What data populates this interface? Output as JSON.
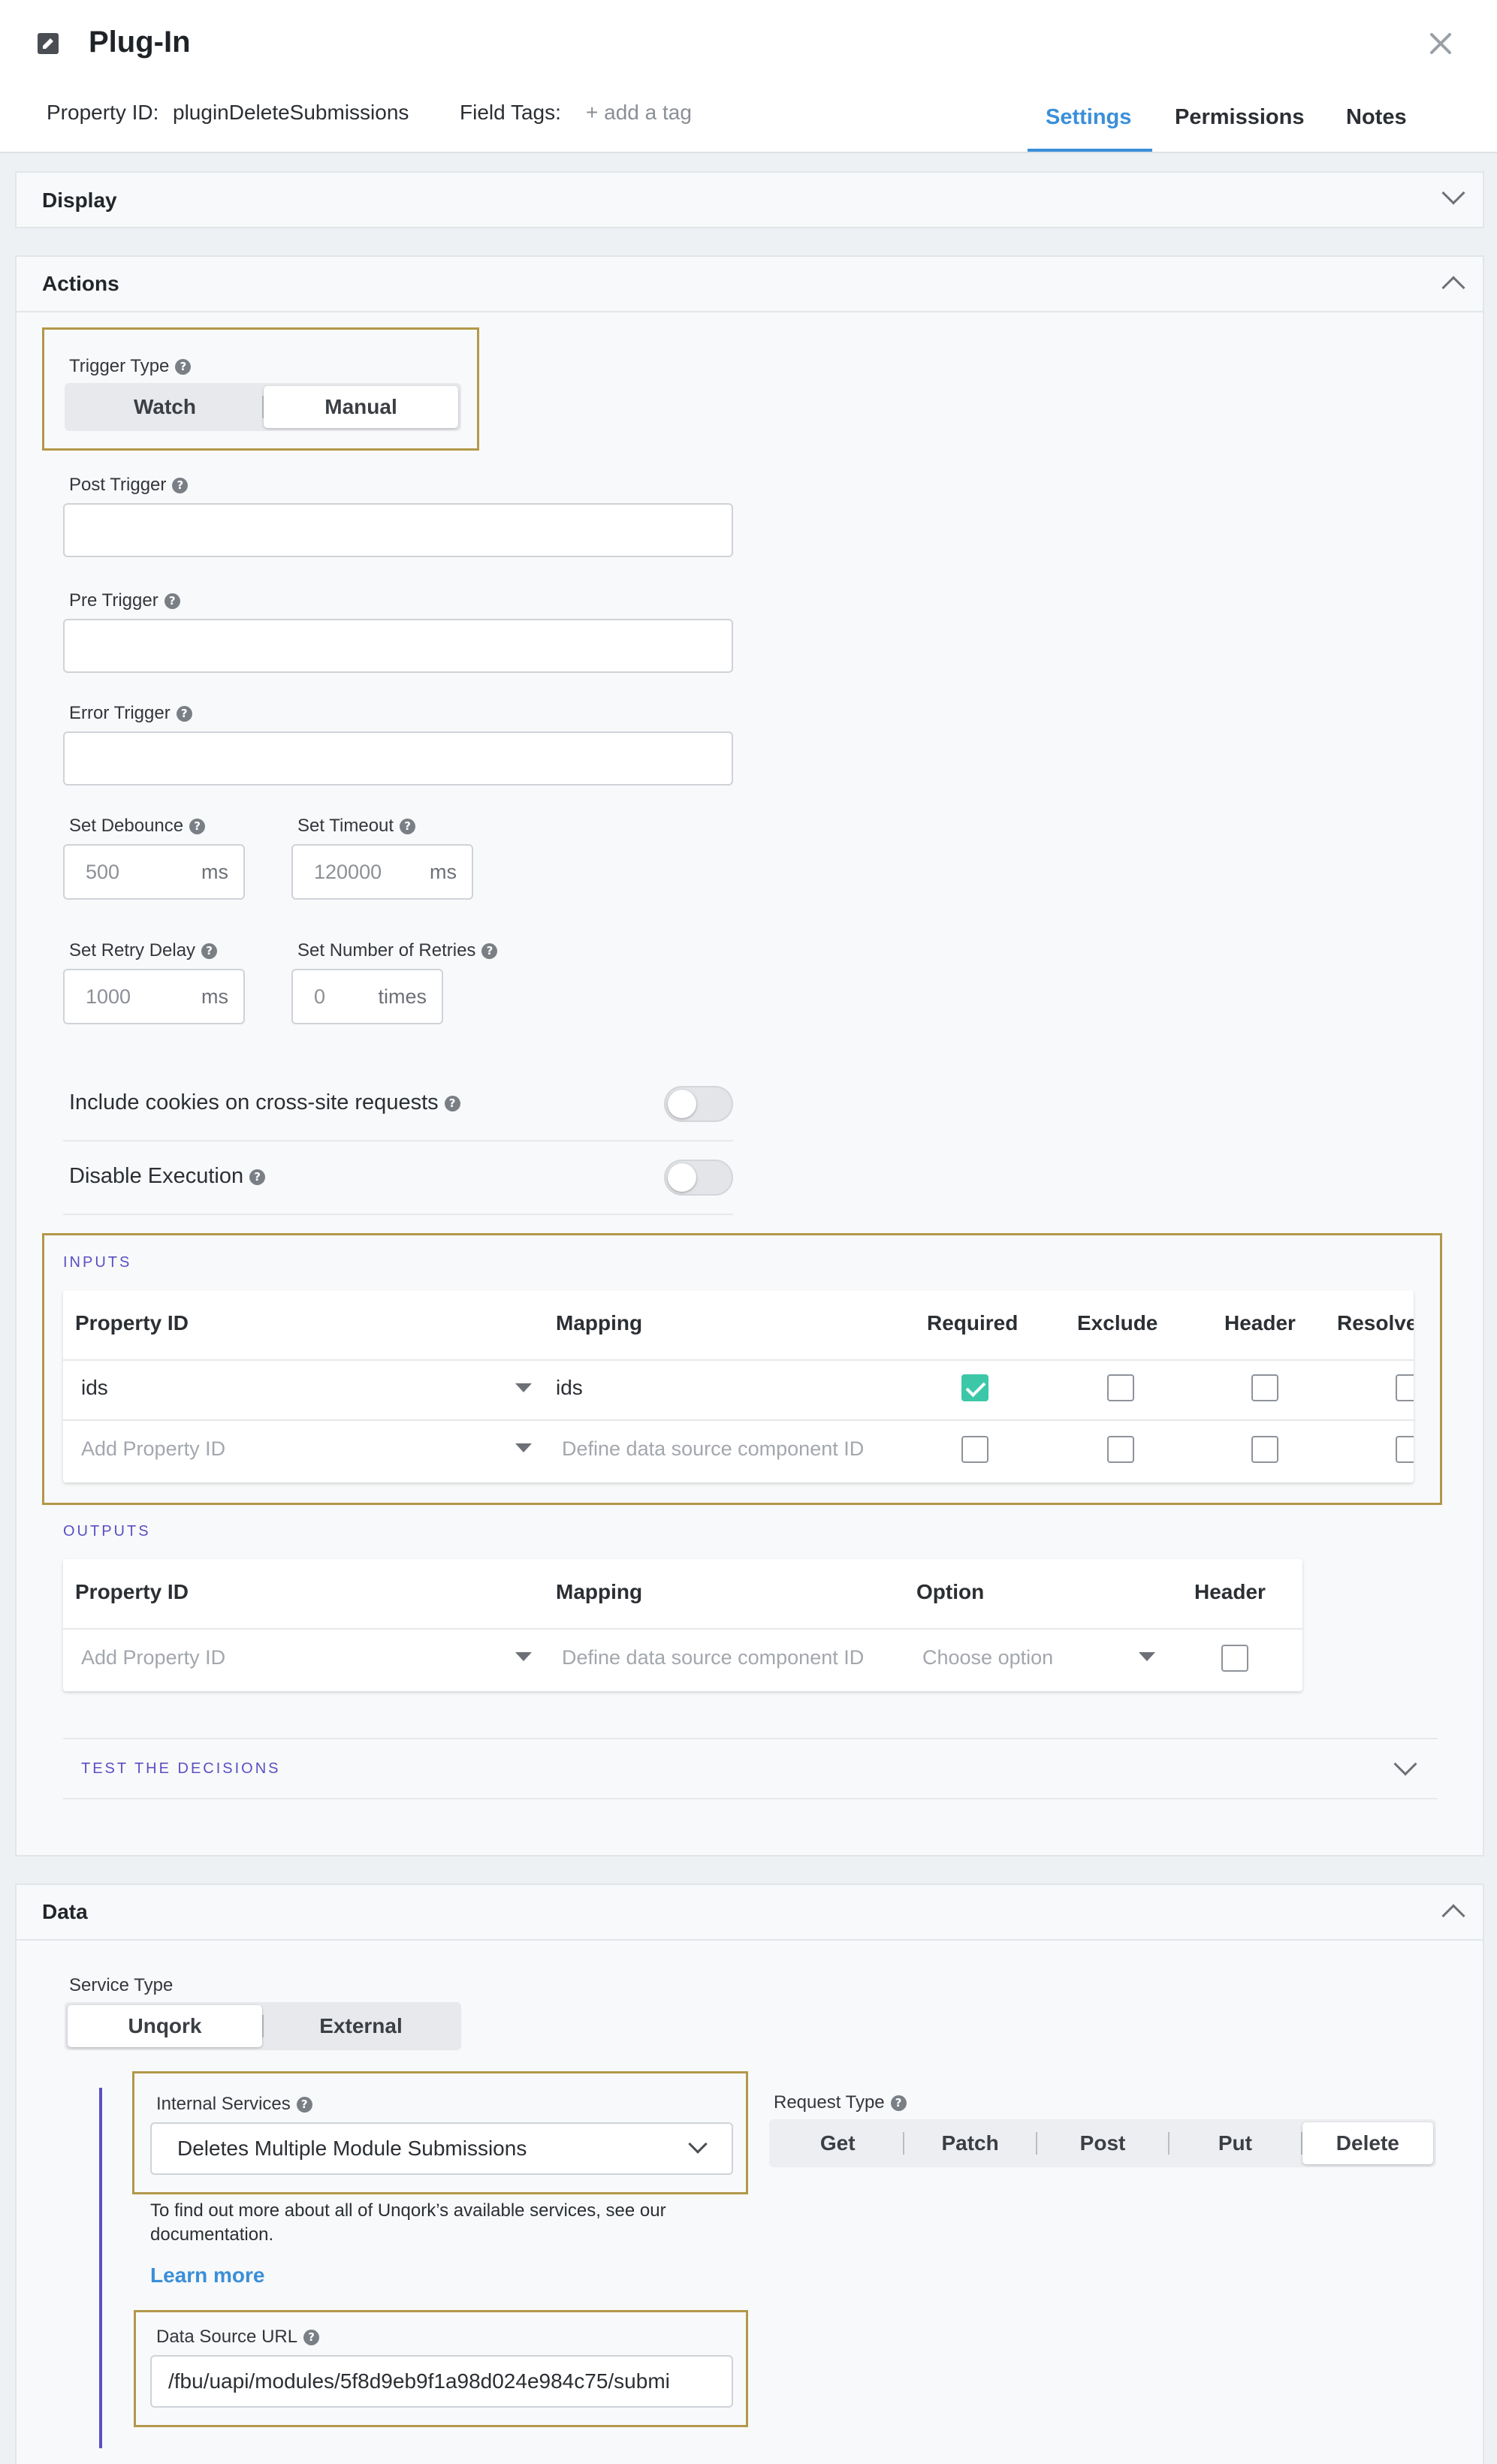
{
  "header": {
    "title": "Plug-In",
    "property_id_label": "Property ID:",
    "property_id_value": "pluginDeleteSubmissions",
    "field_tags_label": "Field Tags:",
    "add_tag": "+ add a tag",
    "tabs": [
      {
        "label": "Settings",
        "active": true
      },
      {
        "label": "Permissions",
        "active": false
      },
      {
        "label": "Notes",
        "active": false
      }
    ],
    "accent_color": "#3a8fd9"
  },
  "display_panel": {
    "title": "Display"
  },
  "actions_panel": {
    "title": "Actions",
    "trigger_type": {
      "label": "Trigger Type",
      "options": [
        "Watch",
        "Manual"
      ],
      "selected": "Manual"
    },
    "post_trigger": {
      "label": "Post Trigger",
      "value": ""
    },
    "pre_trigger": {
      "label": "Pre Trigger",
      "value": ""
    },
    "error_trigger": {
      "label": "Error Trigger",
      "value": ""
    },
    "debounce": {
      "label": "Set Debounce",
      "placeholder": "500",
      "unit": "ms"
    },
    "timeout": {
      "label": "Set Timeout",
      "placeholder": "120000",
      "unit": "ms"
    },
    "retry_delay": {
      "label": "Set Retry Delay",
      "placeholder": "1000",
      "unit": "ms"
    },
    "retries": {
      "label": "Set Number of Retries",
      "placeholder": "0",
      "unit": "times"
    },
    "cookies_toggle": {
      "label": "Include cookies on cross-site requests",
      "on": false
    },
    "disable_toggle": {
      "label": "Disable Execution",
      "on": false
    },
    "inputs": {
      "title": "INPUTS",
      "columns": [
        "Property ID",
        "Mapping",
        "Required",
        "Exclude",
        "Header",
        "Resolve"
      ],
      "rows": [
        {
          "property_id": "ids",
          "mapping": "ids",
          "required": true,
          "exclude": false,
          "header": false,
          "resolve": false
        }
      ],
      "new_row": {
        "property_placeholder": "Add Property ID",
        "mapping_placeholder": "Define data source component ID"
      }
    },
    "outputs": {
      "title": "OUTPUTS",
      "columns": [
        "Property ID",
        "Mapping",
        "Option",
        "Header"
      ],
      "new_row": {
        "property_placeholder": "Add Property ID",
        "mapping_placeholder": "Define data source component ID",
        "option_placeholder": "Choose option"
      }
    },
    "test_decisions": "TEST THE DECISIONS"
  },
  "data_panel": {
    "title": "Data",
    "service_type": {
      "label": "Service Type",
      "options": [
        "Unqork",
        "External"
      ],
      "selected": "Unqork"
    },
    "internal_services": {
      "label": "Internal Services",
      "value": "Deletes Multiple Module Submissions"
    },
    "request_type": {
      "label": "Request Type",
      "options": [
        "Get",
        "Patch",
        "Post",
        "Put",
        "Delete"
      ],
      "selected": "Delete"
    },
    "help_text": "To find out more about all of Unqork’s available services, see our documentation.",
    "learn_more": "Learn more",
    "data_source_url": {
      "label": "Data Source URL",
      "value": "/fbu/uapi/modules/5f8d9eb9f1a98d024e984c75/submi"
    }
  },
  "colors": {
    "highlight": "#b3984a",
    "check": "#3cc8a8",
    "section_title": "#5b4fc4"
  }
}
